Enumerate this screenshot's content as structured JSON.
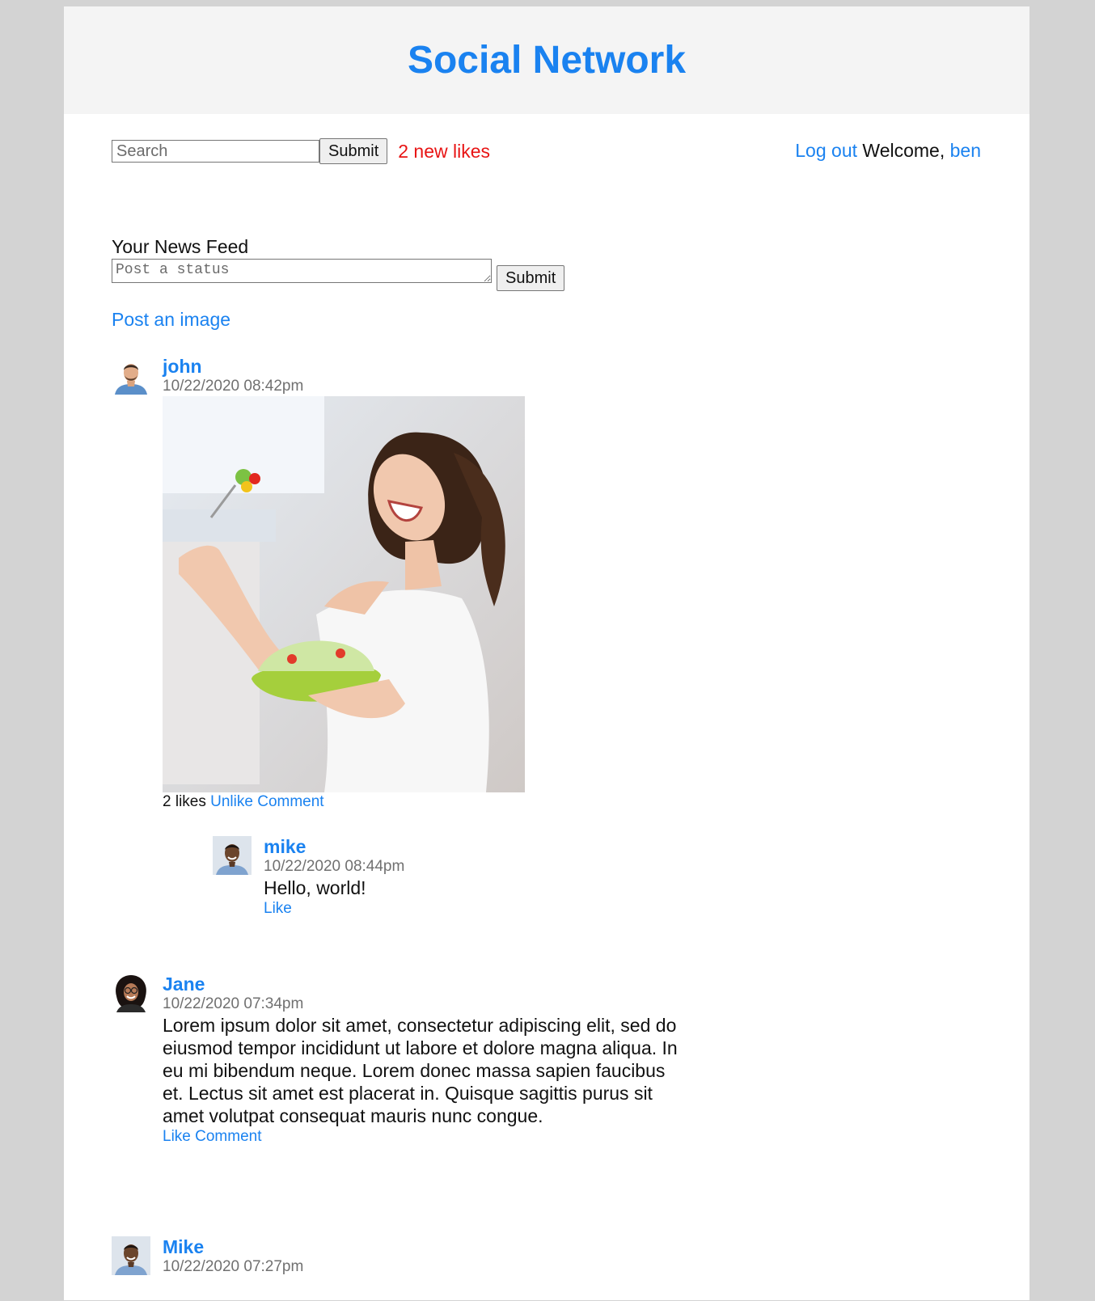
{
  "site": {
    "title": "Social Network"
  },
  "topbar": {
    "search_placeholder": "Search",
    "search_button": "Submit",
    "notifications": "2 new likes",
    "logout": "Log out",
    "welcome": "Welcome,",
    "username": "ben"
  },
  "feed": {
    "heading": "Your News Feed",
    "status_placeholder": "Post a status",
    "status_submit": "Submit",
    "post_image_link": "Post an image"
  },
  "posts": [
    {
      "author": "john",
      "timestamp": "10/22/2020 08:42pm",
      "image": "photo of a laughing woman holding a bowl of salad",
      "likes_text": "2 likes",
      "action_1": "Unlike",
      "action_2": "Comment",
      "comments": [
        {
          "author": "mike",
          "timestamp": "10/22/2020 08:44pm",
          "text": "Hello, world!",
          "action": "Like"
        }
      ]
    },
    {
      "author": "Jane",
      "timestamp": "10/22/2020 07:34pm",
      "text": "Lorem ipsum dolor sit amet, consectetur adipiscing elit, sed do eiusmod tempor incididunt ut labore et dolore magna aliqua. In eu mi bibendum neque. Lorem donec massa sapien faucibus et. Lectus sit amet est placerat in. Quisque sagittis purus sit amet volutpat consequat mauris nunc congue.",
      "action_1": "Like",
      "action_2": "Comment"
    },
    {
      "author": "Mike",
      "timestamp": "10/22/2020 07:27pm"
    }
  ],
  "colors": {
    "link": "#1a82f0",
    "alert": "#e81414",
    "header_bg": "#f4f4f4",
    "page_bg": "#d3d3d3"
  },
  "icons": [
    "avatar-john",
    "avatar-mike",
    "avatar-jane"
  ]
}
